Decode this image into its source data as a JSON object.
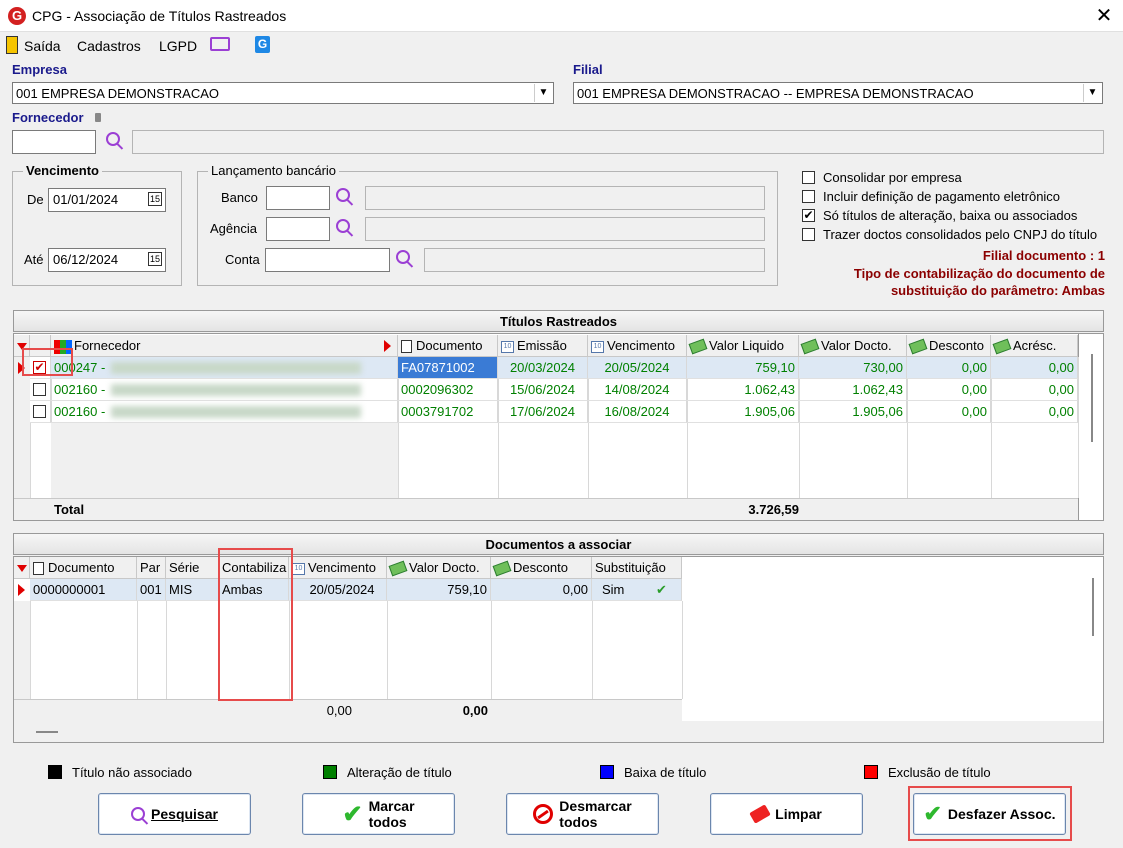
{
  "window": {
    "title": "CPG - Associação de Títulos Rastreados",
    "close": "✕",
    "logo": "G"
  },
  "menu": {
    "saida": "Saída",
    "cadastros": "Cadastros",
    "lgpd": "LGPD"
  },
  "empresa": {
    "label": "Empresa",
    "value": "001 EMPRESA DEMONSTRACAO"
  },
  "filial": {
    "label": "Filial",
    "value": "001 EMPRESA DEMONSTRACAO -- EMPRESA DEMONSTRACAO"
  },
  "fornecedor": {
    "label": "Fornecedor"
  },
  "vencimento": {
    "title": "Vencimento",
    "de_label": "De",
    "de_value": "01/01/2024",
    "ate_label": "Até",
    "ate_value": "06/12/2024"
  },
  "lancamento": {
    "title": "Lançamento bancário",
    "banco": "Banco",
    "agencia": "Agência",
    "conta": "Conta"
  },
  "options": [
    {
      "label": "Consolidar por empresa",
      "checked": false
    },
    {
      "label": "Incluir definição de pagamento eletrônico",
      "checked": false
    },
    {
      "label": "Só títulos de alteração, baixa ou associados",
      "checked": true
    },
    {
      "label": "Trazer doctos consolidados pelo CNPJ do título",
      "checked": false
    }
  ],
  "info": {
    "filial_doc": "Filial documento : 1",
    "tipo_line1": "Tipo de contabilização do documento de",
    "tipo_line2": "substituição do parâmetro: Ambas"
  },
  "titulos": {
    "title": "Títulos Rastreados",
    "headers": [
      "Fornecedor",
      "Documento",
      "Emissão",
      "Vencimento",
      "Valor Liquido",
      "Valor Docto.",
      "Desconto",
      "Acrésc."
    ],
    "rows": [
      {
        "checked": true,
        "fornecedor": "000247 -",
        "documento": "FA07871002",
        "emissao": "20/03/2024",
        "vencimento": "20/05/2024",
        "liquido": "759,10",
        "docto": "730,00",
        "desconto": "0,00",
        "acresc": "0,00"
      },
      {
        "checked": false,
        "fornecedor": "002160 -",
        "documento": "0002096302",
        "emissao": "15/06/2024",
        "vencimento": "14/08/2024",
        "liquido": "1.062,43",
        "docto": "1.062,43",
        "desconto": "0,00",
        "acresc": "0,00"
      },
      {
        "checked": false,
        "fornecedor": "002160 -",
        "documento": "0003791702",
        "emissao": "17/06/2024",
        "vencimento": "16/08/2024",
        "liquido": "1.905,06",
        "docto": "1.905,06",
        "desconto": "0,00",
        "acresc": "0,00"
      }
    ],
    "total_label": "Total",
    "total_value": "3.726,59"
  },
  "documentos": {
    "title": "Documentos a associar",
    "headers": [
      "Documento",
      "Par",
      "Série",
      "Contabiliza",
      "Vencimento",
      "Valor Docto.",
      "Desconto",
      "Substituição"
    ],
    "row": {
      "documento": "0000000001",
      "par": "001",
      "serie": "MIS",
      "contabiliza": "Ambas",
      "vencimento": "20/05/2024",
      "valor": "759,10",
      "desconto": "0,00",
      "subst": "Sim",
      "subst_mark": "✔"
    },
    "total_valor": "0,00",
    "total_desconto": "0,00"
  },
  "legend": [
    {
      "label": "Título não associado",
      "color": "#000000"
    },
    {
      "label": "Alteração de título",
      "color": "#008000"
    },
    {
      "label": "Baixa de título",
      "color": "#0000ff"
    },
    {
      "label": "Exclusão de título",
      "color": "#ff0000"
    }
  ],
  "buttons": {
    "pesquisar": "Pesquisar",
    "marcar1": "Marcar",
    "marcar2": "todos",
    "desmarcar1": "Desmarcar",
    "desmarcar2": "todos",
    "limpar": "Limpar",
    "desfazer": "Desfazer Assoc."
  }
}
